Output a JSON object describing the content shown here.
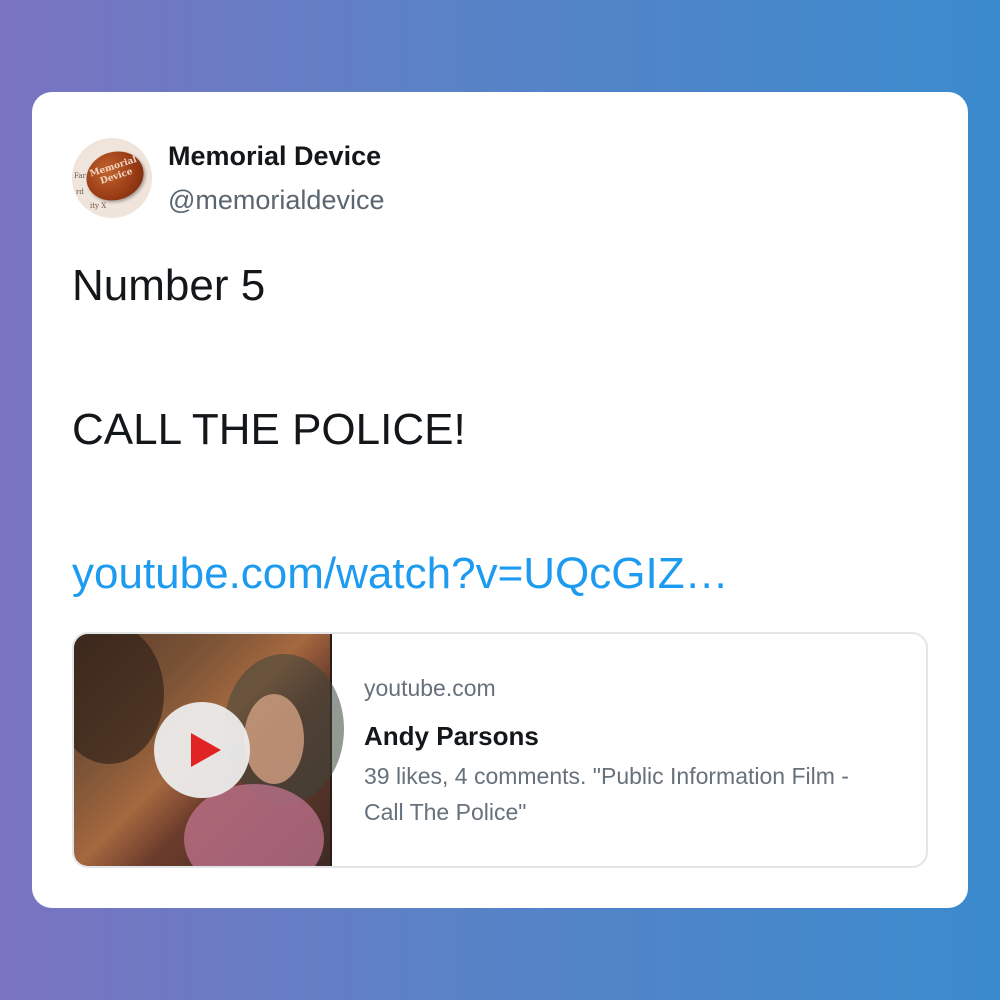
{
  "tweet": {
    "author": {
      "display_name": "Memorial Device",
      "handle": "@memorialdevice"
    },
    "lines": [
      "Number 5",
      "CALL THE POLICE!"
    ],
    "link_text": "youtube.com/watch?v=UQcGIZ…"
  },
  "avatar": {
    "badge_text": "Memorial Device",
    "side_text_left": "Far",
    "side_text_left2": "rd",
    "side_text_bottom": "ity X"
  },
  "link_preview": {
    "domain": "youtube.com",
    "title": "Andy Parsons",
    "description": "39 likes, 4 comments. \"Public Information Film - Call The Police\"",
    "play_icon": "play-icon"
  },
  "colors": {
    "link": "#1d9bf0",
    "play": "#e02323",
    "background_left": "#7a73c0",
    "background_right": "#3a8bcd"
  }
}
